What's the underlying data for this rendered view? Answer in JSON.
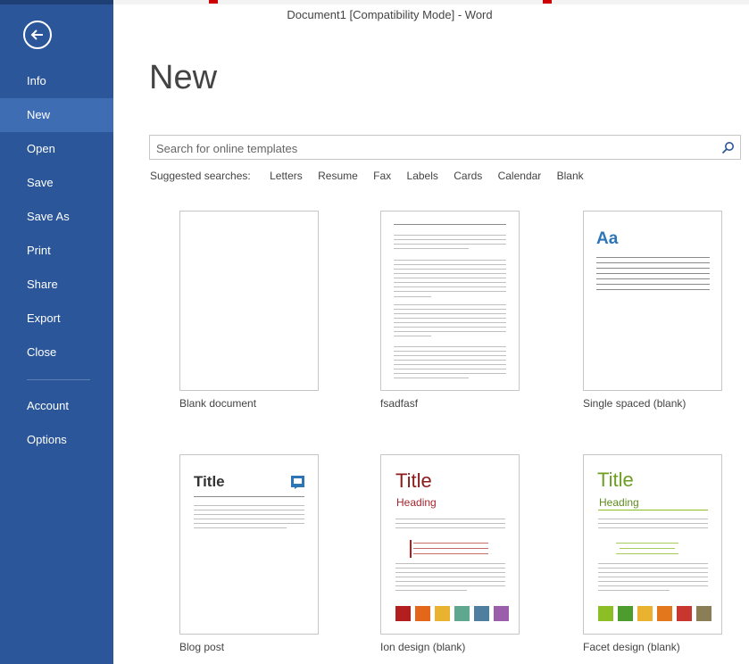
{
  "window": {
    "title": "Document1 [Compatibility Mode] - Word"
  },
  "sidebar": {
    "back_icon": "back-arrow-icon",
    "items": [
      {
        "label": "Info"
      },
      {
        "label": "New",
        "active": true
      },
      {
        "label": "Open"
      },
      {
        "label": "Save"
      },
      {
        "label": "Save As"
      },
      {
        "label": "Print"
      },
      {
        "label": "Share"
      },
      {
        "label": "Export"
      },
      {
        "label": "Close"
      },
      {
        "label": "Account"
      },
      {
        "label": "Options"
      }
    ]
  },
  "main": {
    "heading": "New",
    "search": {
      "placeholder": "Search for online templates",
      "value": "",
      "icon": "search-icon"
    },
    "suggested": {
      "label": "Suggested searches:",
      "items": [
        "Letters",
        "Resume",
        "Fax",
        "Labels",
        "Cards",
        "Calendar",
        "Blank"
      ]
    },
    "templates": [
      {
        "caption": "Blank document"
      },
      {
        "caption": "fsadfasf"
      },
      {
        "caption": "Single spaced (blank)",
        "thumb_text": "Aa"
      },
      {
        "caption": "Blog post",
        "thumb_title": "Title"
      },
      {
        "caption": "Ion design (blank)",
        "thumb_title": "Title",
        "thumb_heading": "Heading"
      },
      {
        "caption": "Facet design (blank)",
        "thumb_title": "Title",
        "thumb_heading": "Heading"
      }
    ]
  },
  "colors": {
    "sidebar": "#2b579a",
    "sidebar_active": "#3e6db4",
    "ion_title": "#a4262c",
    "facet_title": "#5e8c1f",
    "ion_swatches": [
      "#b31e1e",
      "#e2671b",
      "#e9b32f",
      "#5fa78f",
      "#4f7f9f",
      "#9b5eaa"
    ],
    "facet_swatches": [
      "#8cbf26",
      "#4c9c2e",
      "#e9b32f",
      "#e2781b",
      "#c8372d",
      "#8a7e56"
    ]
  }
}
